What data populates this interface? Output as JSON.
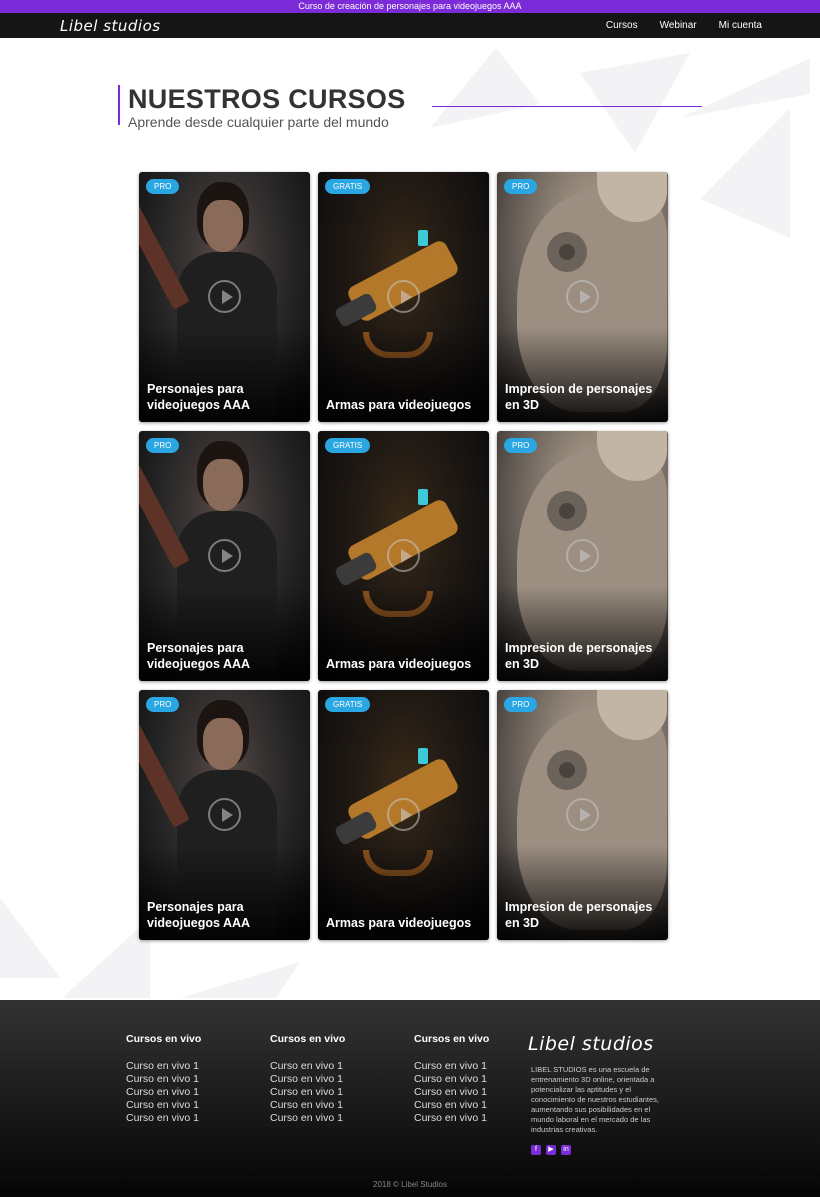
{
  "topbar": {
    "text": "Curso de creación de personajes para videojuegos AAA"
  },
  "nav": {
    "logo": "Libel studios",
    "links": [
      "Cursos",
      "Webinar",
      "Mi cuenta"
    ]
  },
  "header": {
    "title": "NUESTROS CURSOS",
    "subtitle": "Aprende desde cualquier parte del mundo"
  },
  "cards": [
    {
      "badge": "PRO",
      "title": "Personajes para videojuegos AAA",
      "image": "girl"
    },
    {
      "badge": "GRATIS",
      "title": "Armas para videojuegos",
      "image": "gun"
    },
    {
      "badge": "PRO",
      "title": "Impresion de personajes en 3D",
      "image": "bot"
    },
    {
      "badge": "PRO",
      "title": "Personajes para videojuegos AAA",
      "image": "girl"
    },
    {
      "badge": "GRATIS",
      "title": "Armas para videojuegos",
      "image": "gun"
    },
    {
      "badge": "PRO",
      "title": "Impresion de personajes en 3D",
      "image": "bot"
    },
    {
      "badge": "PRO",
      "title": "Personajes para videojuegos AAA",
      "image": "girl"
    },
    {
      "badge": "GRATIS",
      "title": "Armas para videojuegos",
      "image": "gun"
    },
    {
      "badge": "PRO",
      "title": "Impresion de personajes en 3D",
      "image": "bot"
    }
  ],
  "footer": {
    "columns": [
      {
        "heading": "Cursos en vivo",
        "items": [
          "Curso en vivo 1",
          "Curso en vivo 1",
          "Curso en vivo 1",
          "Curso en vivo 1",
          "Curso en vivo 1"
        ]
      },
      {
        "heading": "Cursos en vivo",
        "items": [
          "Curso en vivo 1",
          "Curso en vivo 1",
          "Curso en vivo 1",
          "Curso en vivo 1",
          "Curso en vivo 1"
        ]
      },
      {
        "heading": "Cursos en vivo",
        "items": [
          "Curso en vivo 1",
          "Curso en vivo 1",
          "Curso en vivo 1",
          "Curso en vivo 1",
          "Curso en vivo 1"
        ]
      }
    ],
    "logo": "Libel studios",
    "description": "LIBEL STUDIOS es una escuela de entrenamiento 3D online, orientada a potencializar las aptitudes y el conocimiento de nuestros estudiantes, aumentando sus posibilidades en el mundo laboral en el mercado de las industrias creativas.",
    "social": [
      "facebook-icon",
      "youtube-icon",
      "linkedin-icon"
    ],
    "copyright": "2018 © Libel Studios"
  },
  "colors": {
    "accent": "#7b2cd8",
    "badge": "#2aa7e3"
  }
}
